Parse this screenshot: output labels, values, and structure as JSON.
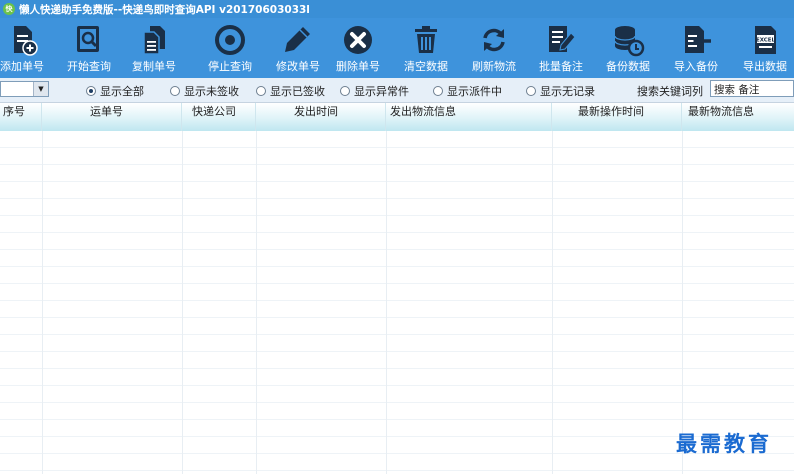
{
  "window": {
    "title": "懒人快递助手免费版--快递鸟即时查询API v20170603033l"
  },
  "toolbar": {
    "items": [
      {
        "label": "添加单号",
        "icon": "add-document-icon"
      },
      {
        "label": "开始查询",
        "icon": "search-document-icon"
      },
      {
        "label": "复制单号",
        "icon": "copy-documents-icon"
      },
      {
        "label": "停止查询",
        "icon": "stop-circle-icon"
      },
      {
        "label": "修改单号",
        "icon": "pencil-icon"
      },
      {
        "label": "删除单号",
        "icon": "delete-x-icon"
      },
      {
        "label": "清空数据",
        "icon": "trash-icon"
      },
      {
        "label": "刷新物流",
        "icon": "refresh-icon"
      },
      {
        "label": "批量备注",
        "icon": "batch-note-icon"
      },
      {
        "label": "备份数据",
        "icon": "backup-database-icon"
      },
      {
        "label": "导入备份",
        "icon": "import-icon"
      },
      {
        "label": "导出数据",
        "icon": "export-excel-icon"
      }
    ],
    "excel_text": "EXCEL"
  },
  "filter": {
    "radios": [
      {
        "label": "显示全部",
        "checked": true
      },
      {
        "label": "显示未签收",
        "checked": false
      },
      {
        "label": "显示已签收",
        "checked": false
      },
      {
        "label": "显示异常件",
        "checked": false
      },
      {
        "label": "显示派件中",
        "checked": false
      },
      {
        "label": "显示无记录",
        "checked": false
      }
    ],
    "search_label": "搜索关键词列",
    "search_value": "搜索 备注"
  },
  "table": {
    "columns": [
      "序号",
      "运单号",
      "快递公司",
      "发出时间",
      "发出物流信息",
      "最新操作时间",
      "最新物流信息"
    ]
  },
  "watermark": "最需教育",
  "colors": {
    "titlebar": "#3a8fd6",
    "toolbar": "#3e93dc",
    "header_tint": "#bfe7f0"
  }
}
